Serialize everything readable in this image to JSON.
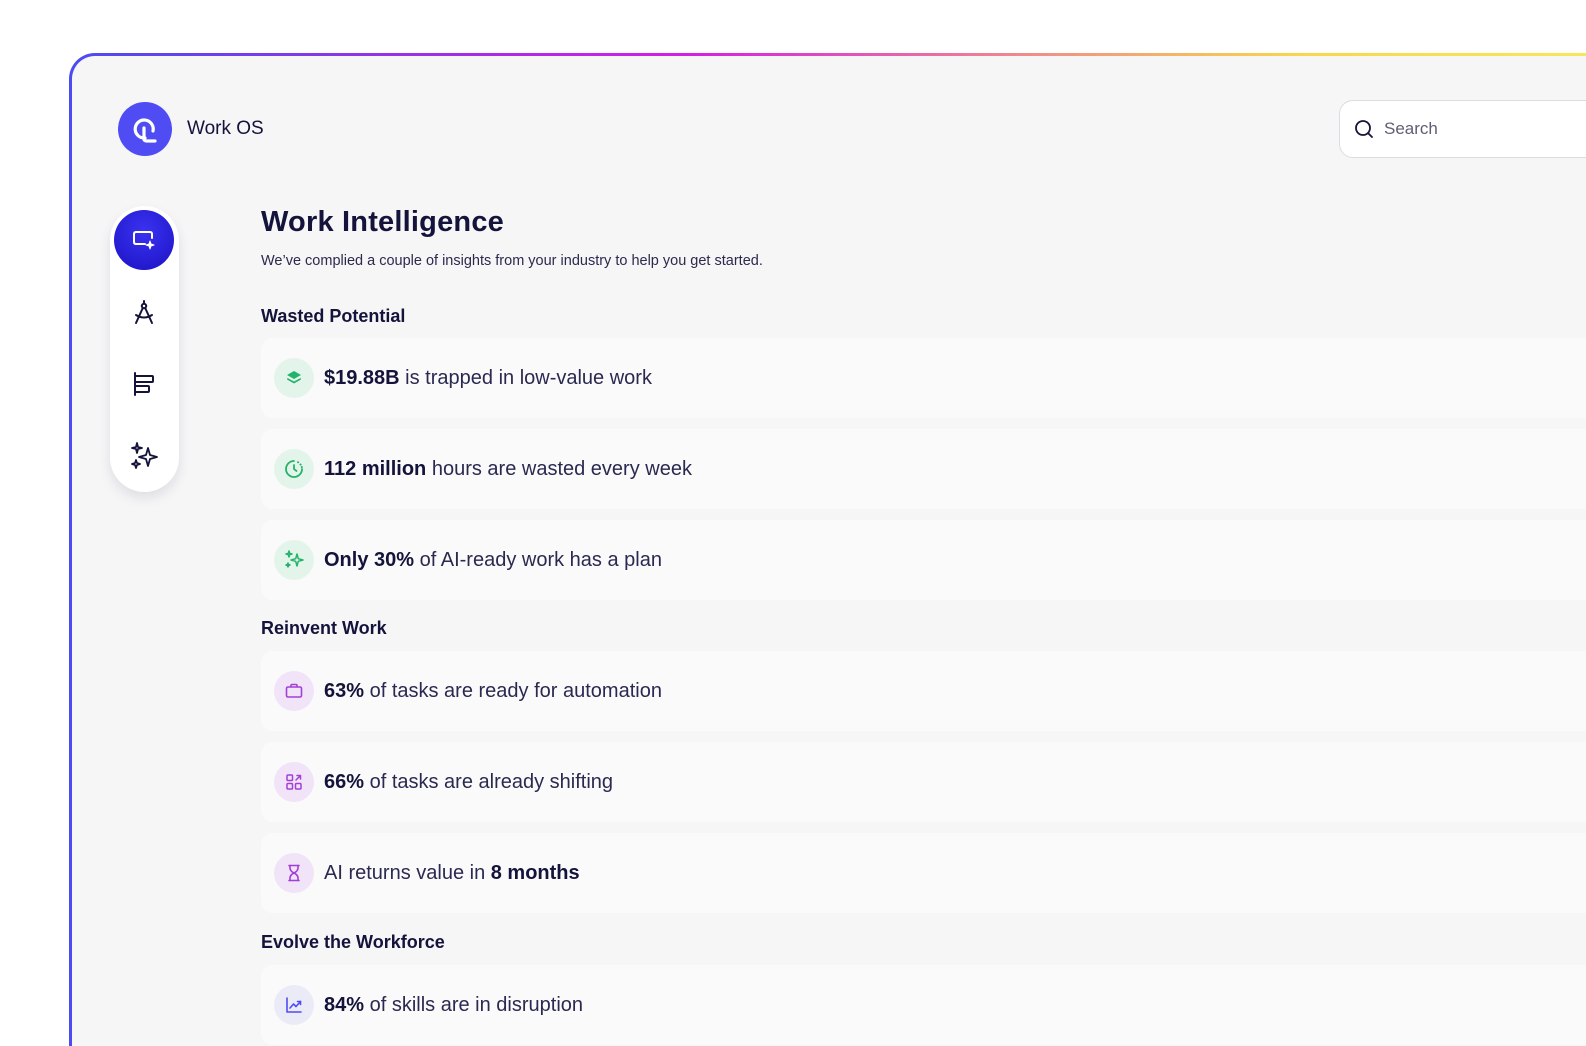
{
  "app": {
    "name": "Work OS"
  },
  "search": {
    "placeholder": "Search"
  },
  "page": {
    "title": "Work Intelligence",
    "subtitle": "We’ve complied a couple of insights from your industry to help you get started."
  },
  "sections": [
    {
      "title": "Wasted Potential",
      "items": [
        {
          "bold": "$19.88B",
          "text": " is trapped in low-value work",
          "icon": "layers-icon"
        },
        {
          "bold": "112 million",
          "text": " hours are wasted every week",
          "icon": "clock-icon"
        },
        {
          "bold": "Only 30%",
          "text": " of AI-ready work has a plan",
          "icon": "sparkle-icon"
        }
      ]
    },
    {
      "title": "Reinvent Work",
      "items": [
        {
          "bold": "63%",
          "text": " of tasks are ready for automation",
          "icon": "briefcase-icon"
        },
        {
          "bold": "66%",
          "text": " of tasks are already shifting",
          "icon": "grid-shift-icon"
        },
        {
          "pre": "AI returns value in ",
          "bold": "8 months",
          "icon": "hourglass-icon"
        }
      ]
    },
    {
      "title": "Evolve the Workforce",
      "items": [
        {
          "bold": "84%",
          "text": " of skills are in disruption",
          "icon": "trend-chart-icon"
        }
      ]
    }
  ],
  "rail": [
    "ai-screen-icon",
    "compass-icon",
    "align-bars-icon",
    "sparkles-icon"
  ],
  "colors": {
    "brand": "#4f4cf4",
    "green": "#24b36b",
    "purple": "#a23fd6",
    "text": "#14133b"
  }
}
